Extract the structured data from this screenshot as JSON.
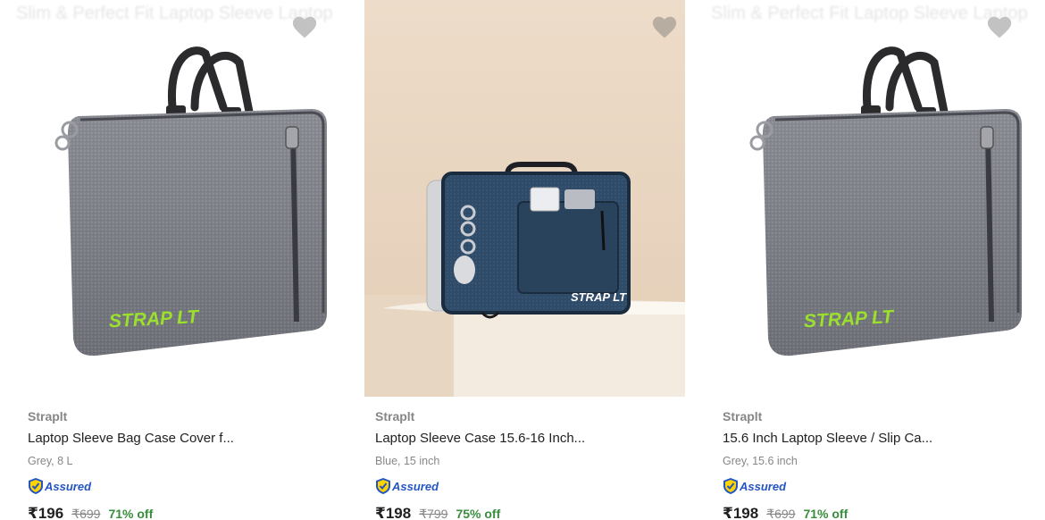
{
  "products": [
    {
      "faded_header": "Slim & Perfect Fit Laptop Sleeve Laptop",
      "brand": "Straplt",
      "title": "Laptop Sleeve Bag Case Cover f...",
      "variant": "Grey, 8 L",
      "assured_label": "Assured",
      "price": "₹196",
      "mrp": "₹699",
      "discount": "71% off",
      "bag_logo": "STRAP LT",
      "bag_color": "#6e7078"
    },
    {
      "faded_header": "",
      "brand": "Straplt",
      "title": "Laptop Sleeve Case 15.6-16 Inch...",
      "variant": "Blue, 15 inch",
      "assured_label": "Assured",
      "price": "₹198",
      "mrp": "₹799",
      "discount": "75% off",
      "bag_logo": "STRAP LT",
      "bag_color": "#2e4a66"
    },
    {
      "faded_header": "Slim & Perfect Fit Laptop Sleeve Laptop",
      "brand": "Straplt",
      "title": "15.6 Inch Laptop Sleeve / Slip Ca...",
      "variant": "Grey, 15.6 inch",
      "assured_label": "Assured",
      "price": "₹198",
      "mrp": "₹699",
      "discount": "71% off",
      "bag_logo": "STRAP LT",
      "bag_color": "#6e7078"
    }
  ],
  "icons": {
    "wishlist": "heart-icon",
    "assured": "assured-shield-icon"
  },
  "colors": {
    "price": "#212121",
    "muted": "#878787",
    "discount": "#388e3c",
    "assured_blue": "#2455c4",
    "logo_green": "#9be02c"
  }
}
